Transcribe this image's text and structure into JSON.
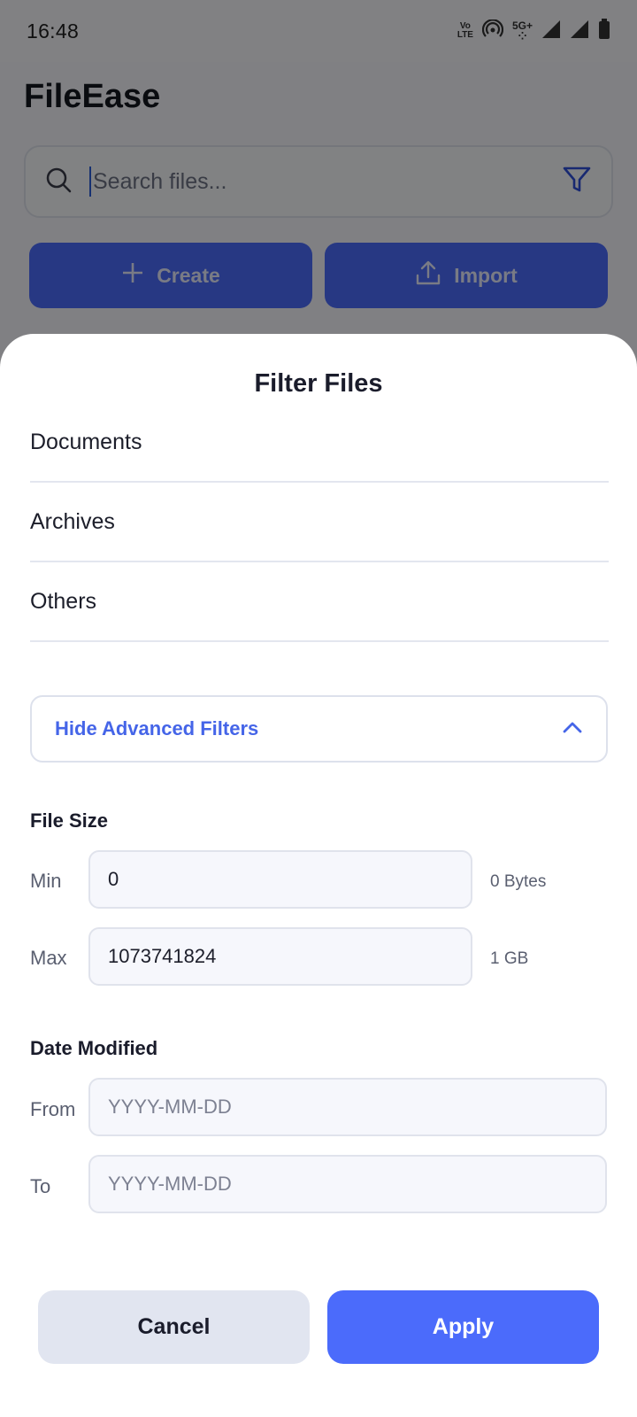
{
  "status_bar": {
    "time": "16:48",
    "volte_top": "Vo",
    "volte_bottom": "LTE",
    "network": "5G+",
    "icons": [
      "volte-icon",
      "hotspot-icon",
      "5g-icon",
      "signal-icon",
      "signal-icon",
      "battery-icon"
    ]
  },
  "app": {
    "title": "FileEase",
    "search": {
      "placeholder": "Search files..."
    },
    "actions": {
      "create_label": "Create",
      "import_label": "Import"
    }
  },
  "sheet": {
    "title": "Filter Files",
    "categories": [
      "Documents",
      "Archives",
      "Others"
    ],
    "advanced_toggle_label": "Hide Advanced Filters",
    "file_size": {
      "title": "File Size",
      "min_label": "Min",
      "min_value": "0",
      "min_hint": "0 Bytes",
      "max_label": "Max",
      "max_value": "1073741824",
      "max_hint": "1 GB"
    },
    "date_modified": {
      "title": "Date Modified",
      "from_label": "From",
      "from_placeholder": "YYYY-MM-DD",
      "to_label": "To",
      "to_placeholder": "YYYY-MM-DD"
    },
    "cancel_label": "Cancel",
    "apply_label": "Apply"
  },
  "colors": {
    "accent": "#4b6bfb",
    "link": "#4565e8",
    "scrim": "rgba(0,0,0,0.48)"
  }
}
